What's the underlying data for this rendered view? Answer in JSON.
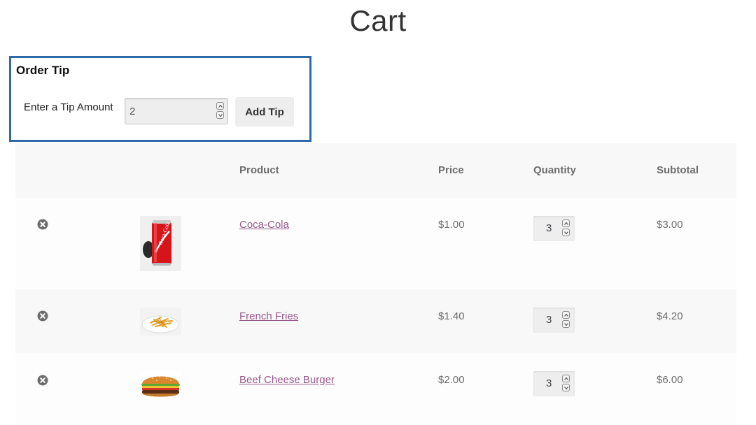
{
  "page": {
    "title": "Cart"
  },
  "tip": {
    "title": "Order Tip",
    "label": "Enter a Tip Amount",
    "value": "2",
    "button_label": "Add Tip"
  },
  "table": {
    "headers": [
      "",
      "",
      "Product",
      "Price",
      "Quantity",
      "Subtotal"
    ],
    "rows": [
      {
        "product": "Coca-Cola",
        "price": "$1.00",
        "quantity": "3",
        "subtotal": "$3.00",
        "image": "coca-cola-can"
      },
      {
        "product": "French Fries",
        "price": "$1.40",
        "quantity": "3",
        "subtotal": "$4.20",
        "image": "french-fries-plate"
      },
      {
        "product": "Beef Cheese Burger",
        "price": "$2.00",
        "quantity": "3",
        "subtotal": "$6.00",
        "image": "cheeseburger"
      }
    ]
  },
  "colors": {
    "tip_border": "#2f6aa5",
    "link": "#96588a",
    "header_bg": "#f8f8f8"
  },
  "icons": {
    "remove": "remove-item-icon",
    "spinner_up": "chevron-up-icon",
    "spinner_down": "chevron-down-icon"
  }
}
